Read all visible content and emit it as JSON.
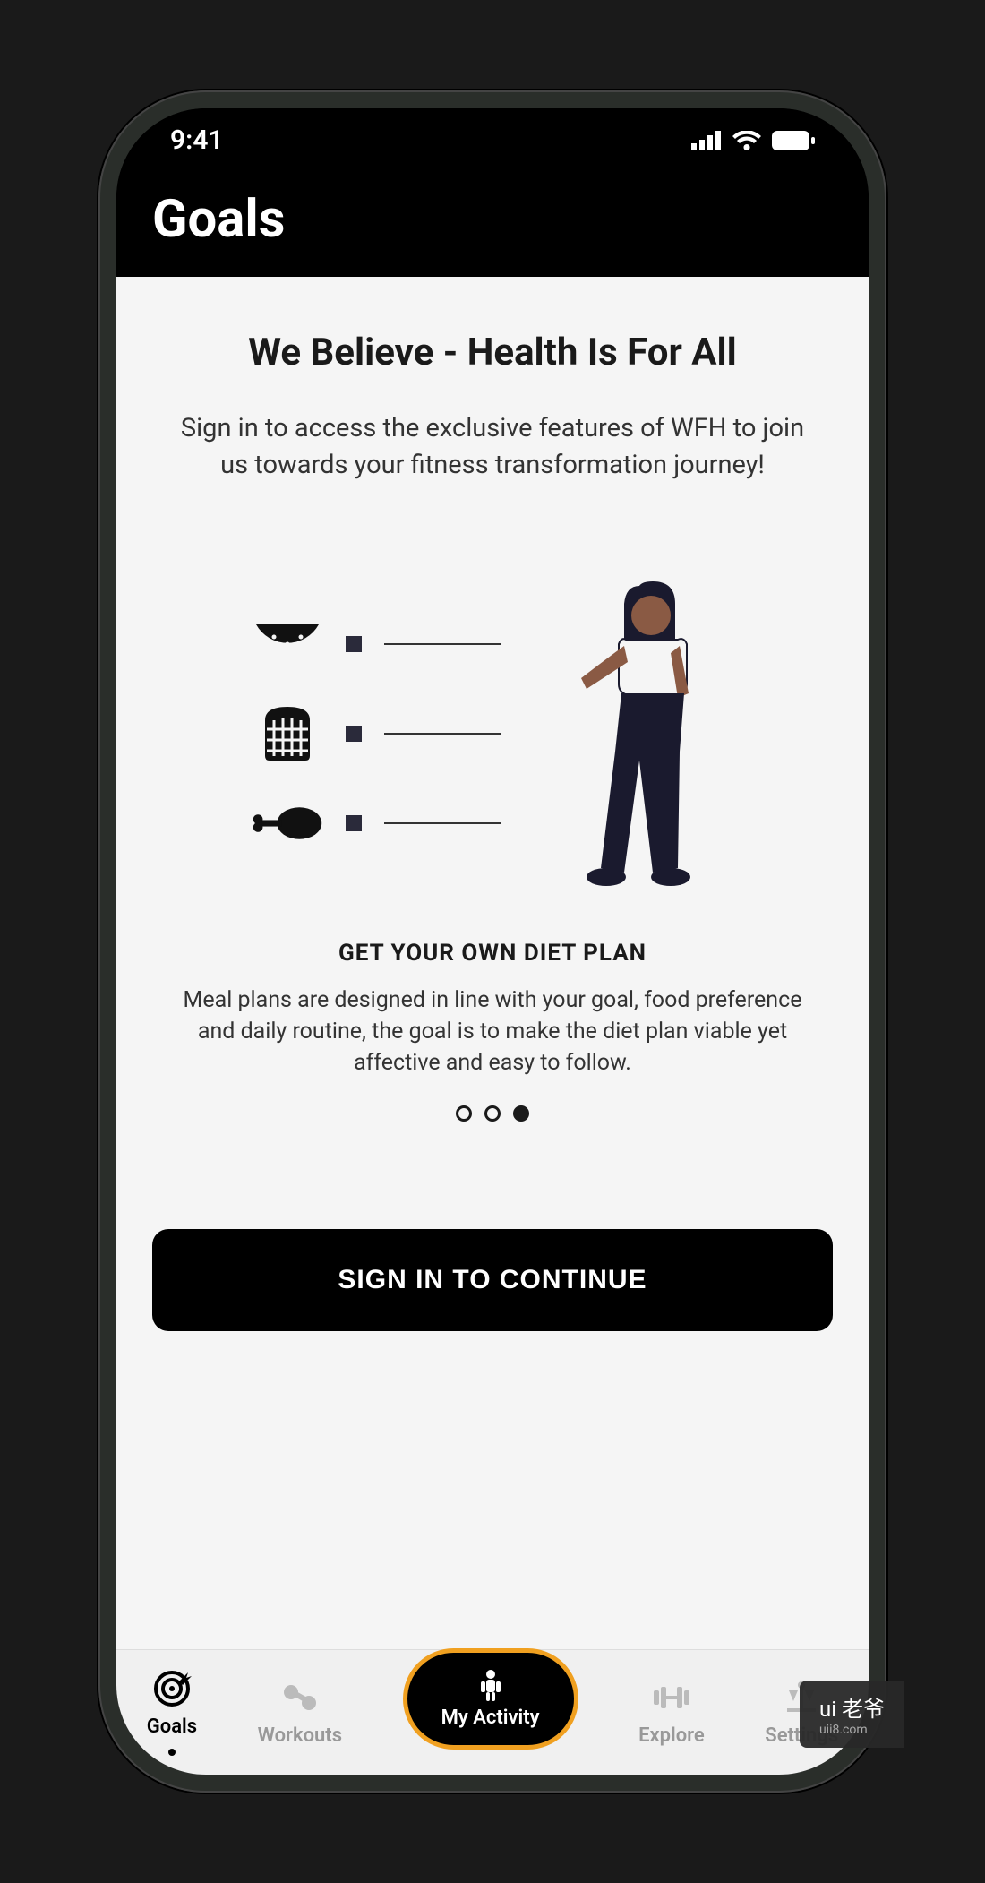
{
  "status": {
    "time": "9:41"
  },
  "header": {
    "title": "Goals"
  },
  "page": {
    "headline": "We Believe - Health Is For All",
    "subheadline": "Sign in to access the exclusive features of WFH to join us towards your fitness transformation journey!",
    "card_title": "GET YOUR OWN DIET PLAN",
    "card_desc": "Meal plans are designed in line with your goal, food preference and daily routine, the goal is to make the diet plan viable yet affective and easy to follow.",
    "cta_label": "SIGN IN TO CONTINUE"
  },
  "pagination": {
    "total": 3,
    "active_index": 2
  },
  "tabs": {
    "goals": "Goals",
    "workouts": "Workouts",
    "activity": "My Activity",
    "explore": "Explore",
    "settings": "Settings"
  },
  "watermark": {
    "brand": "ui 老爷",
    "url": "uii8.com"
  }
}
